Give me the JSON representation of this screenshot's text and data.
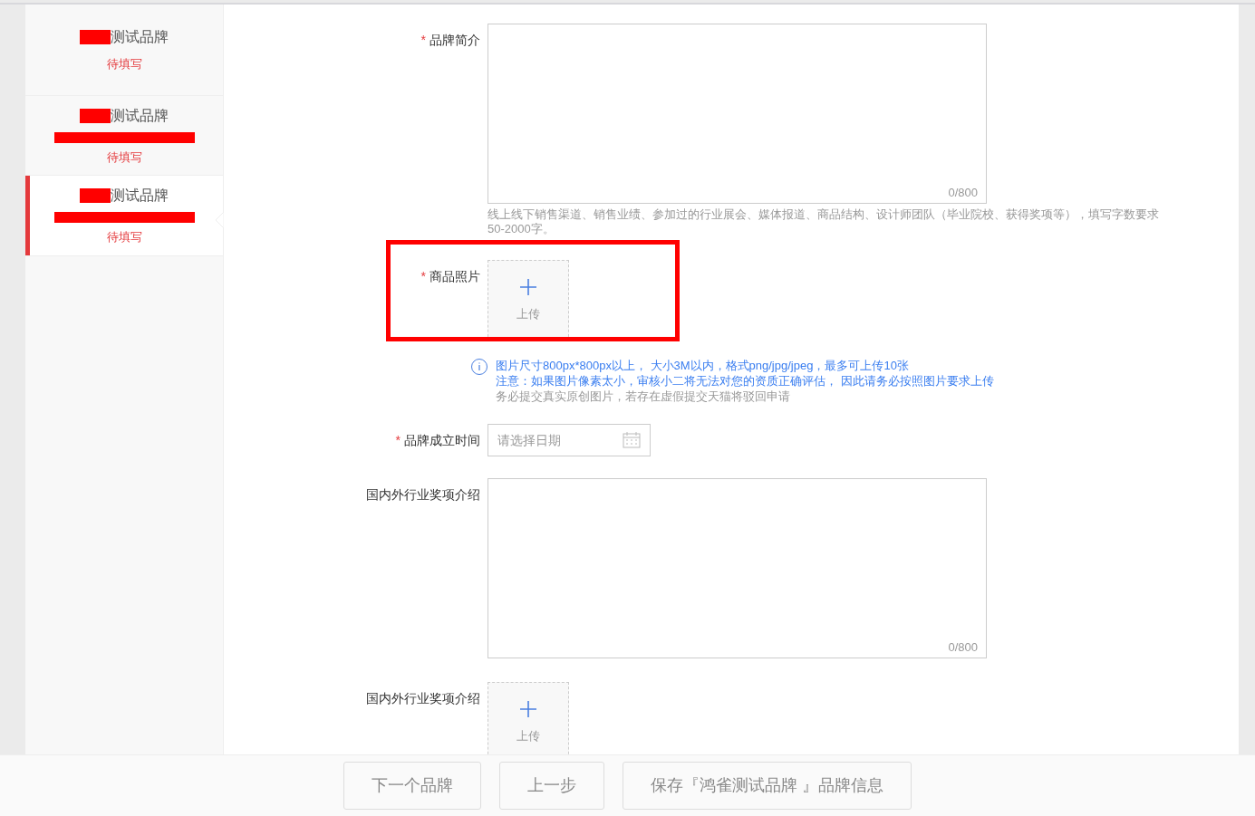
{
  "sidebar": {
    "items": [
      {
        "title": "测试品牌",
        "status": "待填写",
        "selected": false
      },
      {
        "title": "测试品牌",
        "subtitle_redacted": true,
        "status": "待填写",
        "selected": false
      },
      {
        "title": "测试品牌",
        "subtitle_redacted": true,
        "status": "待填写",
        "selected": true
      }
    ]
  },
  "form": {
    "fields": [
      {
        "kind": "textarea",
        "required_mark": "*",
        "label": "品牌简介",
        "counter": "0/800",
        "hint": "线上线下销售渠道、销售业绩、参加过的行业展会、媒体报道、商品结构、设计师团队（毕业院校、获得奖项等），填写字数要求50-2000字。"
      },
      {
        "kind": "upload",
        "required_mark": "*",
        "label": "商品照片",
        "upload_label": "上传",
        "highlighted": true,
        "notes": [
          "图片尺寸800px*800px以上， 大小3M以内，格式png/jpg/jpeg，最多可上传10张",
          "注意：如果图片像素太小，审核小二将无法对您的资质正确评估， 因此请务必按照图片要求上传"
        ],
        "warning": "务必提交真实原创图片，若存在虚假提交天猫将驳回申请"
      },
      {
        "kind": "date",
        "required_mark": "*",
        "label": "品牌成立时间",
        "placeholder": "请选择日期"
      },
      {
        "kind": "textarea",
        "label": "国内外行业奖项介绍",
        "counter": "0/800"
      },
      {
        "kind": "upload",
        "label": "国内外行业奖项介绍",
        "upload_label": "上传"
      }
    ]
  },
  "footer": {
    "buttons": [
      "下一个品牌",
      "上一步",
      "保存『鸿雀测试品牌 』品牌信息"
    ]
  }
}
